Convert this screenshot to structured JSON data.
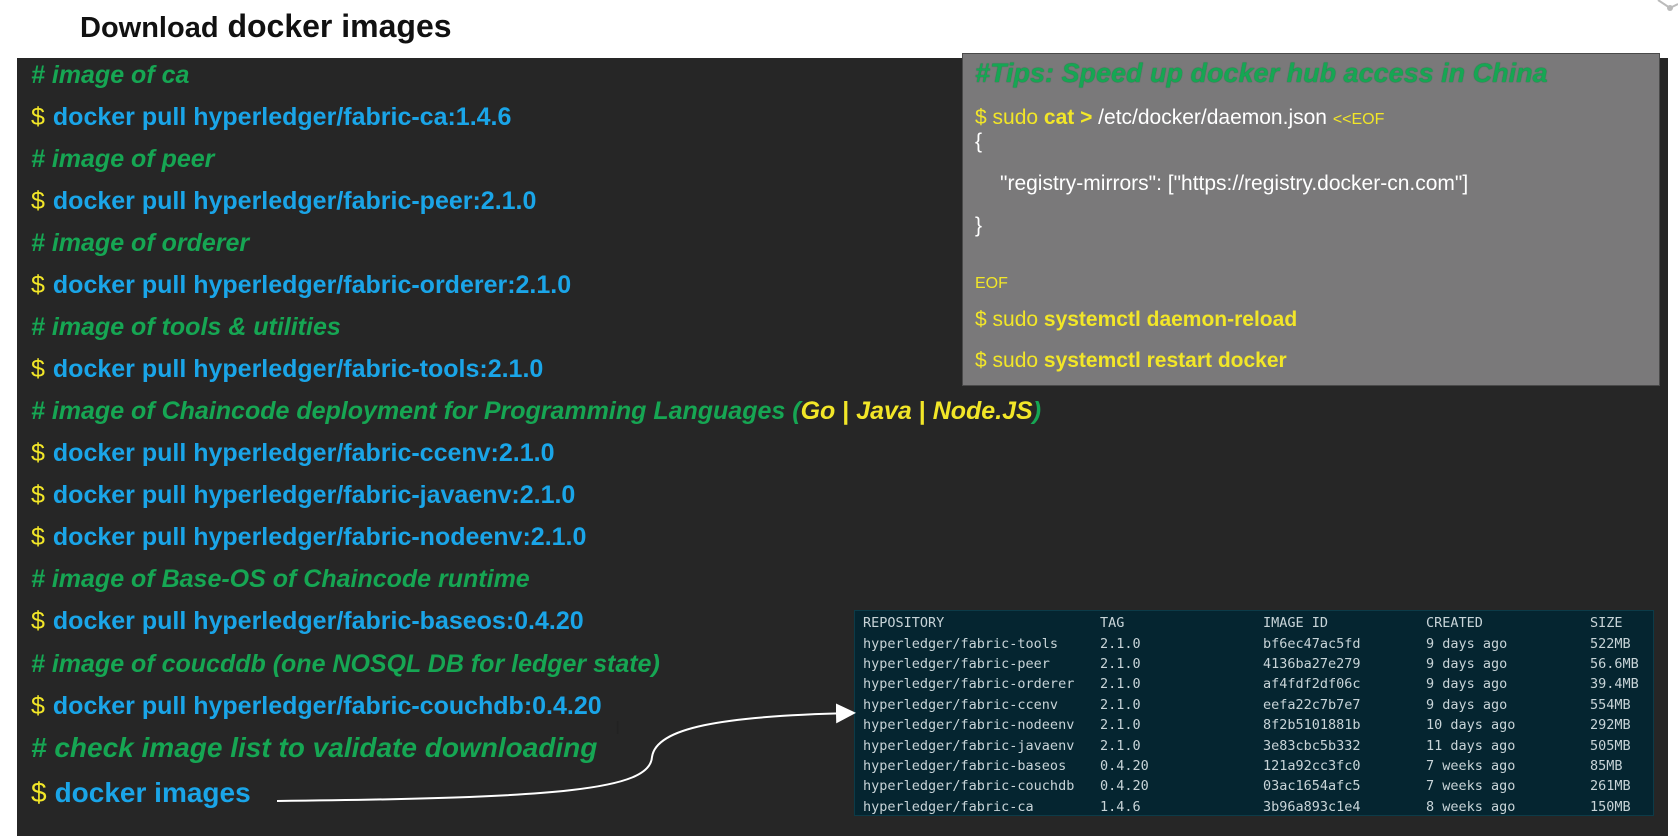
{
  "header": {
    "title_part1": "Download",
    "title_part2": "docker images"
  },
  "terminal": {
    "prompt": "$",
    "comment_ca": "# image of ca",
    "cmd_ca": "docker pull hyperledger/fabric-ca:1.4.6",
    "comment_peer": "# image of peer",
    "cmd_peer": "docker pull hyperledger/fabric-peer:2.1.0",
    "comment_orderer": "# image of orderer",
    "cmd_orderer": "docker pull hyperledger/fabric-orderer:2.1.0",
    "comment_tools": "# image of tools & utilities",
    "cmd_tools": "docker pull hyperledger/fabric-tools:2.1.0",
    "comment_chaincode_prefix": "# image of Chaincode deployment for Programming Languages (",
    "lang_go": "Go",
    "lang_sep": " | ",
    "lang_java": "Java",
    "lang_node": "Node.JS",
    "comment_chaincode_suffix": ")",
    "cmd_ccenv": "docker pull hyperledger/fabric-ccenv:2.1.0",
    "cmd_javaenv": "docker pull hyperledger/fabric-javaenv:2.1.0",
    "cmd_nodeenv": "docker pull hyperledger/fabric-nodeenv:2.1.0",
    "comment_baseos": "# image of Base-OS of Chaincode runtime",
    "cmd_baseos": "docker pull hyperledger/fabric-baseos:0.4.20",
    "comment_couchdb": "# image of coucddb (one NOSQL DB for ledger state)",
    "cmd_couchdb": "docker pull hyperledger/fabric-couchdb:0.4.20",
    "comment_check": "# check image list to validate downloading",
    "cmd_images": "docker images"
  },
  "tips": {
    "title": "#Tips: Speed up docker hub access in China",
    "l1_prompt": "$ sudo ",
    "l1_cat": "cat >",
    "l1_path": " /etc/docker/daemon.json ",
    "l1_eof": "<<EOF",
    "l2": "{",
    "l3": "\"registry-mirrors\": [\"https://registry.docker-cn.com\"]",
    "l4": "}",
    "l5": "EOF",
    "l6_prompt": "$ sudo ",
    "l6_cmd": "systemctl daemon-reload",
    "l7_prompt": "$ sudo ",
    "l7_cmd": "systemctl restart docker"
  },
  "images_table": {
    "headers": [
      "REPOSITORY",
      "TAG",
      "IMAGE ID",
      "CREATED",
      "SIZE"
    ],
    "rows": [
      [
        "hyperledger/fabric-tools",
        "2.1.0",
        "bf6ec47ac5fd",
        "9 days ago",
        "522MB"
      ],
      [
        "hyperledger/fabric-peer",
        "2.1.0",
        "4136ba27e279",
        "9 days ago",
        "56.6MB"
      ],
      [
        "hyperledger/fabric-orderer",
        "2.1.0",
        "af4fdf2df06c",
        "9 days ago",
        "39.4MB"
      ],
      [
        "hyperledger/fabric-ccenv",
        "2.1.0",
        "eefa22c7b7e7",
        "9 days ago",
        "554MB"
      ],
      [
        "hyperledger/fabric-nodeenv",
        "2.1.0",
        "8f2b5101881b",
        "10 days ago",
        "292MB"
      ],
      [
        "hyperledger/fabric-javaenv",
        "2.1.0",
        "3e83cbc5b332",
        "11 days ago",
        "505MB"
      ],
      [
        "hyperledger/fabric-baseos",
        "0.4.20",
        "121a92cc3fc0",
        "7 weeks ago",
        "85MB"
      ],
      [
        "hyperledger/fabric-couchdb",
        "0.4.20",
        "03ac1654afc5",
        "7 weeks ago",
        "261MB"
      ],
      [
        "hyperledger/fabric-ca",
        "1.4.6",
        "3b96a893c1e4",
        "8 weeks ago",
        "150MB"
      ]
    ]
  },
  "colors": {
    "terminal_bg": "#262626",
    "comment": "#16a653",
    "command": "#1aa5e8",
    "prompt": "#f2e628",
    "tips_bg": "#7a797a",
    "table_bg": "#052530"
  },
  "icons": {
    "cursor": "text-cursor-icon",
    "arrow": "arrow-connector-icon"
  }
}
